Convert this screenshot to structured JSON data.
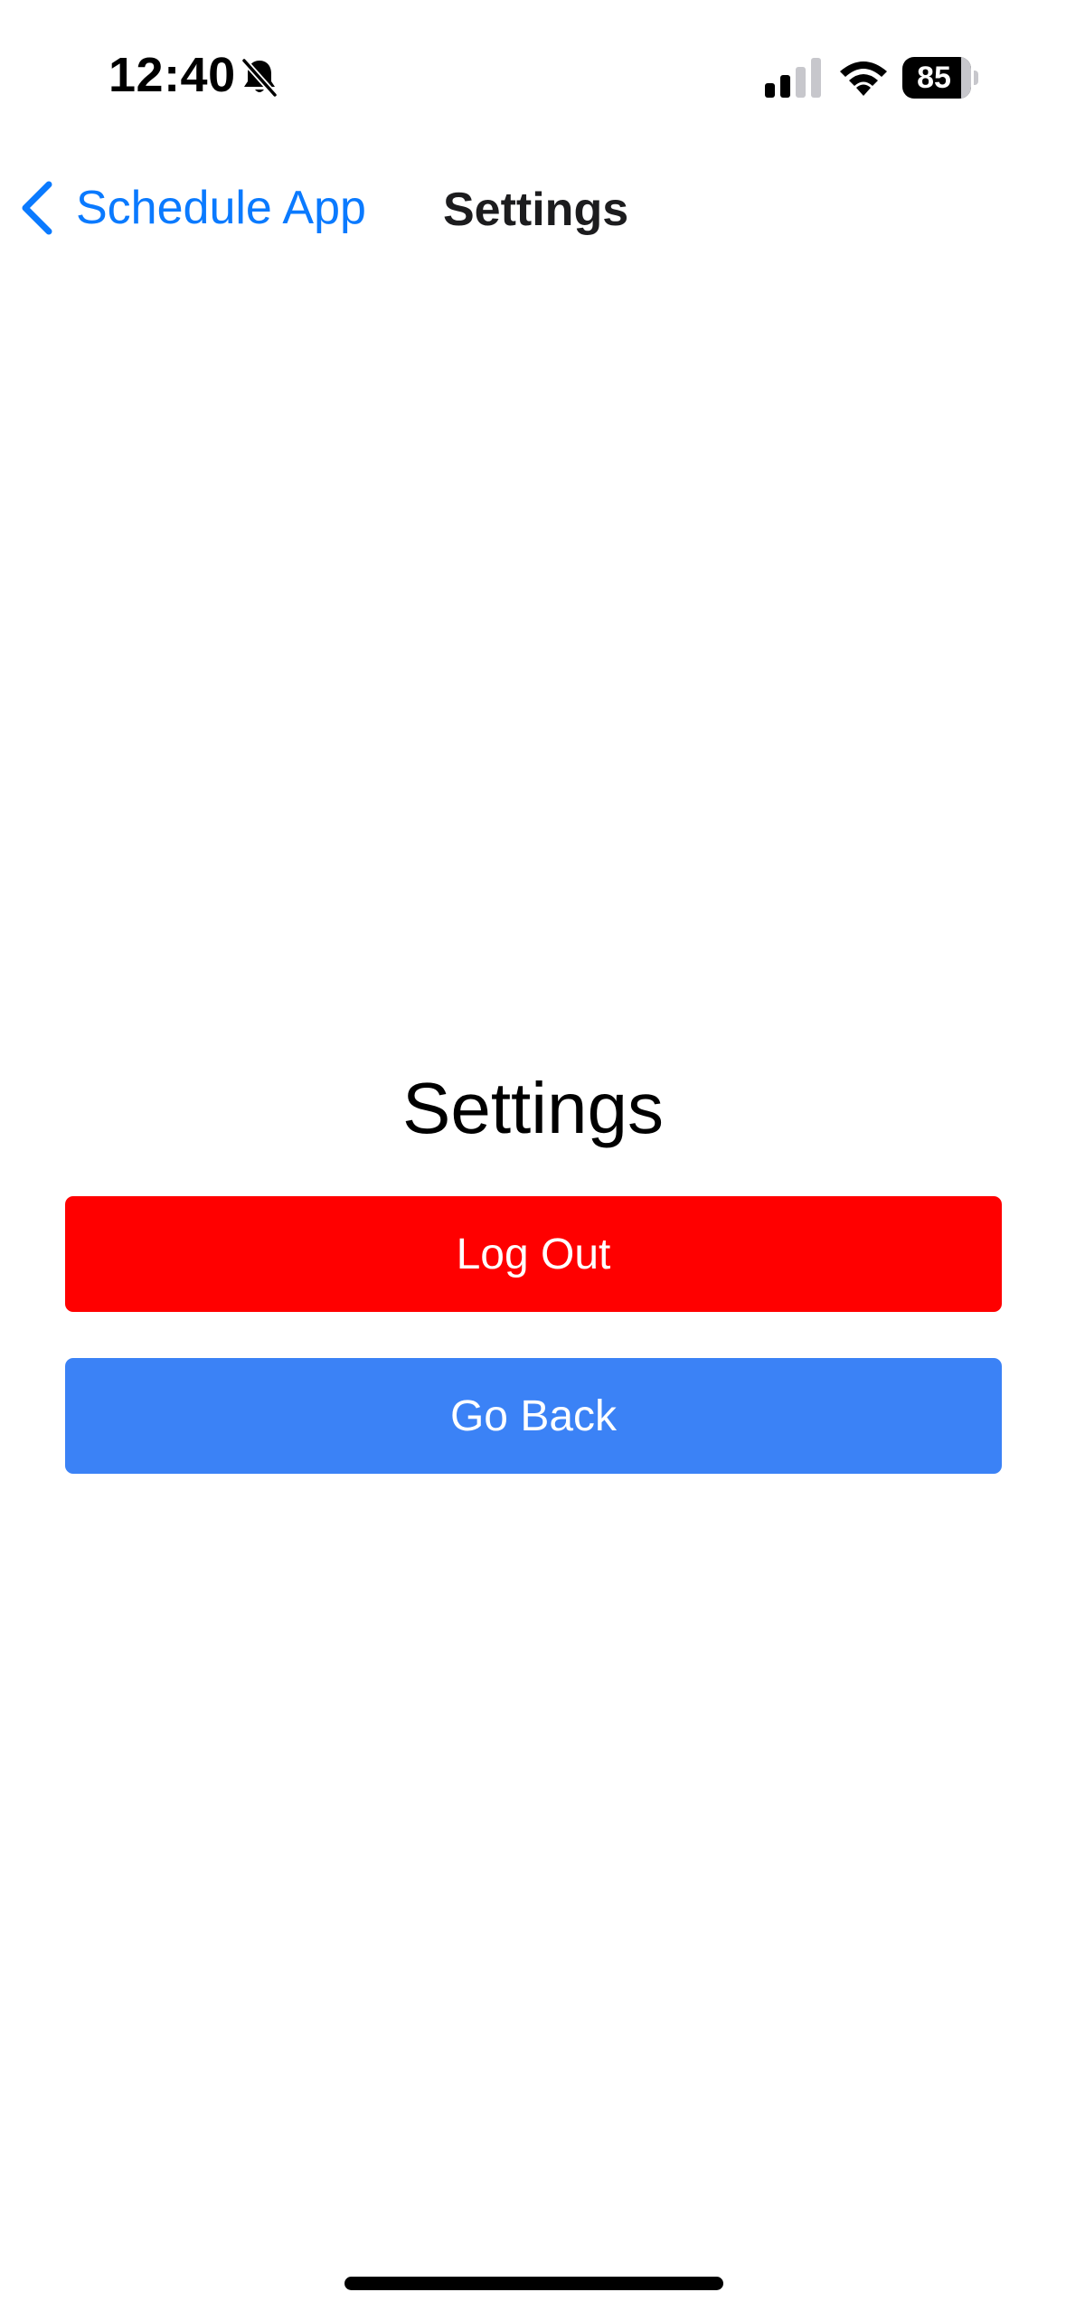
{
  "status_bar": {
    "time": "12:40",
    "silent_icon": "bell-slash-icon",
    "signal_icon": "cellular-signal-icon",
    "signal_bars_active": 2,
    "signal_bars_total": 4,
    "wifi_icon": "wifi-icon",
    "battery_level": "85",
    "battery_fraction": 0.85
  },
  "nav": {
    "back_icon": "chevron-left-icon",
    "back_label": "Schedule App",
    "title": "Settings"
  },
  "main": {
    "heading": "Settings",
    "logout_label": "Log Out",
    "goback_label": "Go Back"
  },
  "colors": {
    "accent_blue": "#0a7aff",
    "logout_red": "#ff0000",
    "goback_blue": "#3b82f6",
    "text_dark": "#1c1c1e"
  }
}
